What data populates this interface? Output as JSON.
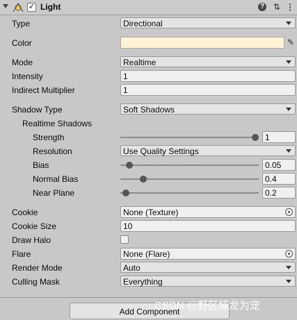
{
  "header": {
    "title": "Light",
    "enabled": true,
    "help_icon": "help-icon",
    "presets_icon": "presets-icon",
    "more_icon": "more-icon"
  },
  "properties": {
    "type": {
      "label": "Type",
      "value": "Directional"
    },
    "color": {
      "label": "Color",
      "value": "#fff4d6"
    },
    "mode": {
      "label": "Mode",
      "value": "Realtime"
    },
    "intensity": {
      "label": "Intensity",
      "value": "1"
    },
    "indirect_multiplier": {
      "label": "Indirect Multiplier",
      "value": "1"
    },
    "shadow_type": {
      "label": "Shadow Type",
      "value": "Soft Shadows"
    },
    "realtime_shadows": {
      "label": "Realtime Shadows"
    },
    "strength": {
      "label": "Strength",
      "value": "1",
      "level": 1.0
    },
    "resolution": {
      "label": "Resolution",
      "value": "Use Quality Settings"
    },
    "bias": {
      "label": "Bias",
      "value": "0.05",
      "level": 0.025
    },
    "normal_bias": {
      "label": "Normal Bias",
      "value": "0.4",
      "level": 0.133
    },
    "near_plane": {
      "label": "Near Plane",
      "value": "0.2",
      "level": 0.0
    },
    "cookie": {
      "label": "Cookie",
      "value": "None (Texture)"
    },
    "cookie_size": {
      "label": "Cookie Size",
      "value": "10"
    },
    "draw_halo": {
      "label": "Draw Halo",
      "checked": false
    },
    "flare": {
      "label": "Flare",
      "value": "None (Flare)"
    },
    "render_mode": {
      "label": "Render Mode",
      "value": "Auto"
    },
    "culling_mask": {
      "label": "Culling Mask",
      "value": "Everything"
    }
  },
  "add_component_label": "Add Component",
  "watermark": "CSDN @野区捕龙为宠"
}
